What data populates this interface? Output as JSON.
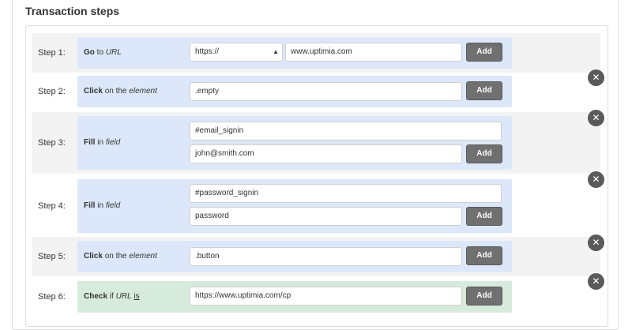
{
  "section": {
    "title": "Transaction steps"
  },
  "steps": [
    {
      "label": "Step 1:",
      "action": {
        "verb": "Go",
        "prep": "to",
        "object": "URL"
      },
      "protocol": "https://",
      "value": "www.uptimia.com",
      "add_label": "Add"
    },
    {
      "label": "Step 2:",
      "action": {
        "verb": "Click",
        "prep": "on the",
        "object": "element"
      },
      "value": ".empty",
      "add_label": "Add",
      "remove_icon": "close-icon"
    },
    {
      "label": "Step 3:",
      "action": {
        "verb": "Fill",
        "prep": "in",
        "object": "field"
      },
      "field": "#email_signin",
      "value": "john@smith.com",
      "add_label": "Add",
      "remove_icon": "close-icon"
    },
    {
      "label": "Step 4:",
      "action": {
        "verb": "Fill",
        "prep": "in",
        "object": "field"
      },
      "field": "#password_signin",
      "value": "password",
      "add_label": "Add",
      "remove_icon": "close-icon"
    },
    {
      "label": "Step 5:",
      "action": {
        "verb": "Click",
        "prep": "on the",
        "object": "element"
      },
      "value": ".button",
      "add_label": "Add",
      "remove_icon": "close-icon"
    },
    {
      "label": "Step 6:",
      "action": {
        "verb": "Check",
        "prep": "if",
        "object": "URL",
        "condition": "is"
      },
      "value": "https://www.uptimia.com/cp",
      "add_label": "Add",
      "remove_icon": "close-icon"
    }
  ],
  "colors": {
    "panel_blue": "#dce8fa",
    "panel_green": "#d7ebdd",
    "button": "#707070",
    "remove_icon": "#5a5a5a"
  }
}
